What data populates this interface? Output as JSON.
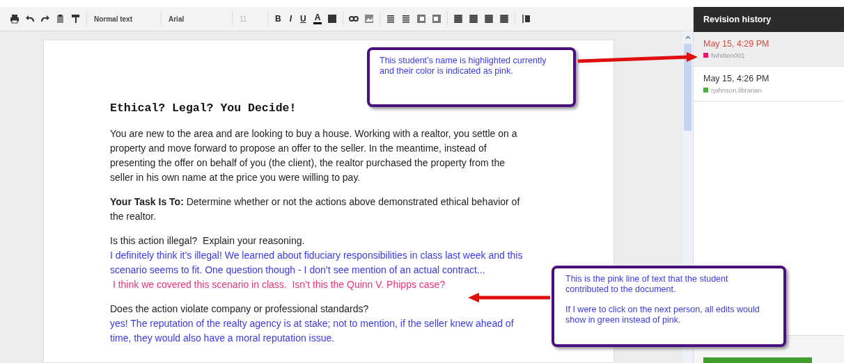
{
  "toolbar": {
    "style": "Normal text",
    "font": "Arial",
    "size": {
      "label": "11",
      "disabled": true
    },
    "format_letters": [
      "B",
      "I",
      "U",
      "A"
    ]
  },
  "document": {
    "title": "Ethical? Legal? You Decide!",
    "sections": [
      [
        {
          "color": "#222222",
          "text": "You are new to the area and are looking to buy a house. Working with a realtor, you settle on a property and move forward to propose an offer to the seller. In the meantime, instead of presenting the offer on behalf of you (the client), the realtor purchased the property from the seller in his own name at the price you were willing to pay."
        }
      ],
      [
        {
          "color": "#222222",
          "text": "**Your Task Is To:** Determine whether or not the actions above demonstrated ethical behavior of the realtor."
        }
      ],
      [
        {
          "color": "#222222",
          "text": "Is this action illegal?  Explain your reasoning."
        },
        {
          "color": "#3a3ae0",
          "text": "I definitely think it’s illegal! We learned about fiduciary responsibilities in class last week and this scenario seems to fit. One question though - I don’t see mention of an actual contract..."
        },
        {
          "color": "#e8327a",
          "text": " I think we covered this scenario in class.  Isn’t this the Quinn V. Phipps case?"
        }
      ],
      [
        {
          "color": "#222222",
          "text": "Does the action violate company or professional standards?"
        },
        {
          "color": "#3a3ae0",
          "text": "yes! The reputation of the realty agency is at stake; not to mention, if the seller knew ahead of time, they would also have a moral reputation issue."
        }
      ]
    ]
  },
  "revision_history": {
    "title": "Revision history",
    "revisions": [
      {
        "time": "May 15, 4:29 PM",
        "user": "fwhitten001",
        "color": "#e8176f",
        "selected": true
      },
      {
        "time": "May 15, 4:26 PM",
        "user": "rjohnson.librarian",
        "color": "#4caf3a",
        "selected": false
      }
    ]
  },
  "annotations": [
    {
      "paragraphs": [
        "This student’s name is highlighted currently and their color is indicated as pink."
      ]
    },
    {
      "paragraphs": [
        "This is the pink line of text that the student contributed to the document.",
        "If I were to click on the next person, all edits would show in green instead of pink."
      ]
    }
  ]
}
